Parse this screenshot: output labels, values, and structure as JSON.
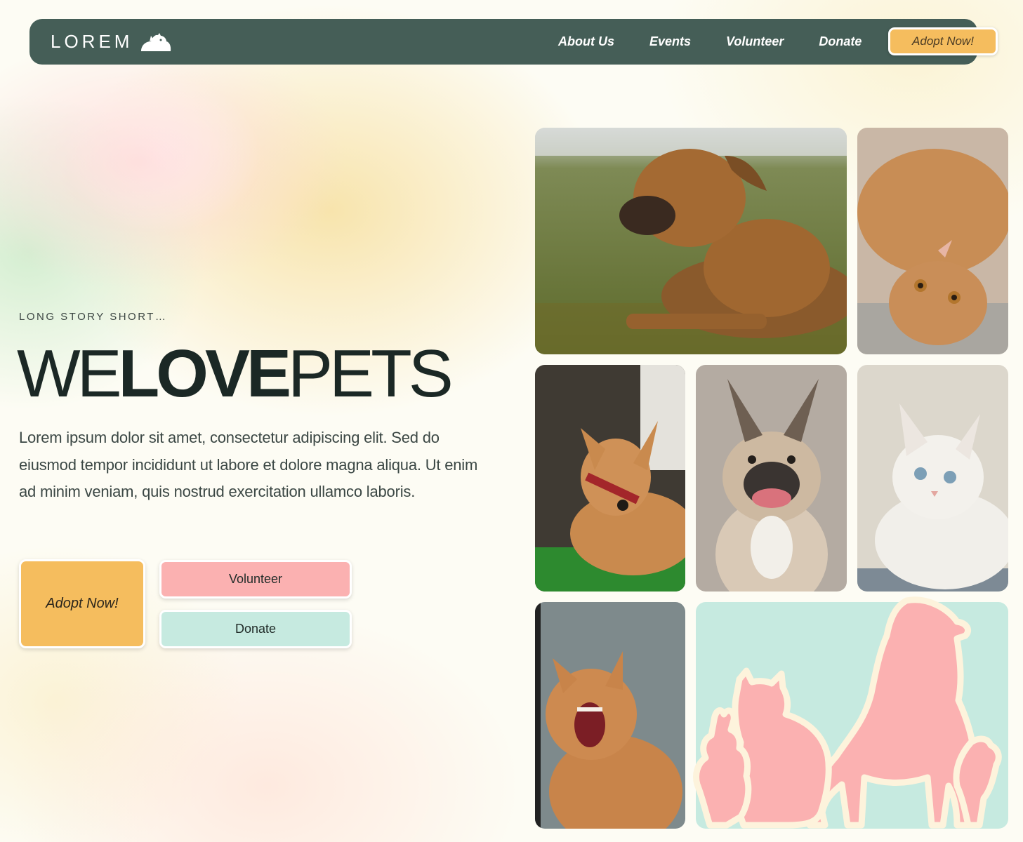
{
  "nav": {
    "brand": "LOREM",
    "links": [
      "About Us",
      "Events",
      "Volunteer",
      "Donate"
    ],
    "cta": "Adopt Now!"
  },
  "hero": {
    "eyebrow": "LONG STORY SHORT…",
    "headline": {
      "part1": "WE",
      "part2": "LOVE",
      "part3": "PETS"
    },
    "lead": "Lorem ipsum dolor sit amet, consectetur adipiscing elit. Sed do eiusmod tempor incididunt ut labore et dolore magna aliqua. Ut enim ad minim veniam, quis nostrud exercitation ullamco laboris.",
    "buttons": {
      "adopt": "Adopt Now!",
      "volunteer": "Volunteer",
      "donate": "Donate"
    }
  },
  "colors": {
    "nav": "#455e57",
    "accent_yellow": "#f5bd5e",
    "accent_pink": "#fbb1b1",
    "accent_mint": "#c6eae0"
  },
  "gallery": {
    "tiles": [
      "dog-brindle-photo",
      "cat-ginger-lying-photo",
      "dog-tan-photo",
      "french-bulldog-photo",
      "cat-white-photo",
      "cat-ginger-yawning-photo",
      "pet-silhouettes-illustration"
    ]
  }
}
